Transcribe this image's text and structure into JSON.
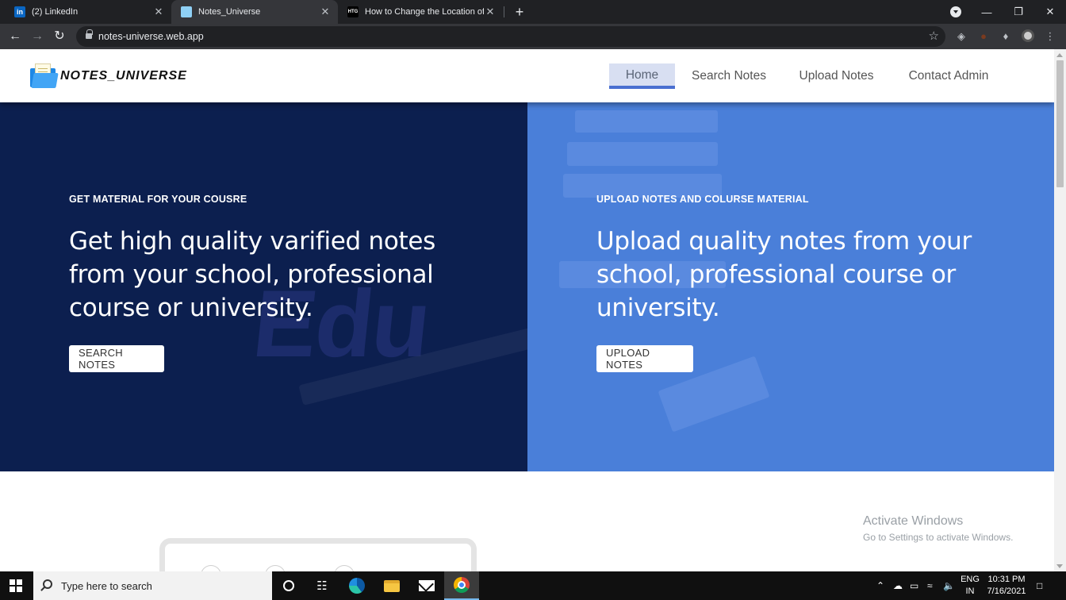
{
  "browser": {
    "tabs": [
      {
        "label": "(2) LinkedIn",
        "favicon": "linkedin-icon",
        "active": false
      },
      {
        "label": "Notes_Universe",
        "favicon": "notes-universe-icon",
        "active": true
      },
      {
        "label": "How to Change the Location of t",
        "favicon": "htg-icon",
        "active": false
      }
    ],
    "favicon_text": {
      "linkedin": "in",
      "htg": "HTG"
    },
    "url": "notes-universe.web.app",
    "new_tab_glyph": "+",
    "close_glyph": "✕"
  },
  "site": {
    "logo_text": "NOTES_UNIVERSE",
    "nav": [
      "Home",
      "Search Notes",
      "Upload Notes",
      "Contact Admin"
    ],
    "active_nav": "Home",
    "hero_left": {
      "eyebrow": "GET MATERIAL FOR YOUR COUSRE",
      "headline": "Get high quality varified notes from your school, professional course or university.",
      "button": "SEARCH NOTES",
      "watermark": "Edu",
      "background": "#0c1f4f"
    },
    "hero_right": {
      "eyebrow": "UPLOAD NOTES AND COLURSE MATERIAL",
      "headline": "Upload quality notes from your school, professional course or university.",
      "button": "UPLOAD NOTES",
      "background": "#4a7fd9"
    },
    "accent": "#4a6fd1"
  },
  "watermark_windows": {
    "title": "Activate Windows",
    "subtitle": "Go to Settings to activate Windows."
  },
  "taskbar": {
    "search_placeholder": "Type here to search",
    "lang_top": "ENG",
    "lang_bottom": "IN",
    "time": "10:31 PM",
    "date": "7/16/2021"
  }
}
